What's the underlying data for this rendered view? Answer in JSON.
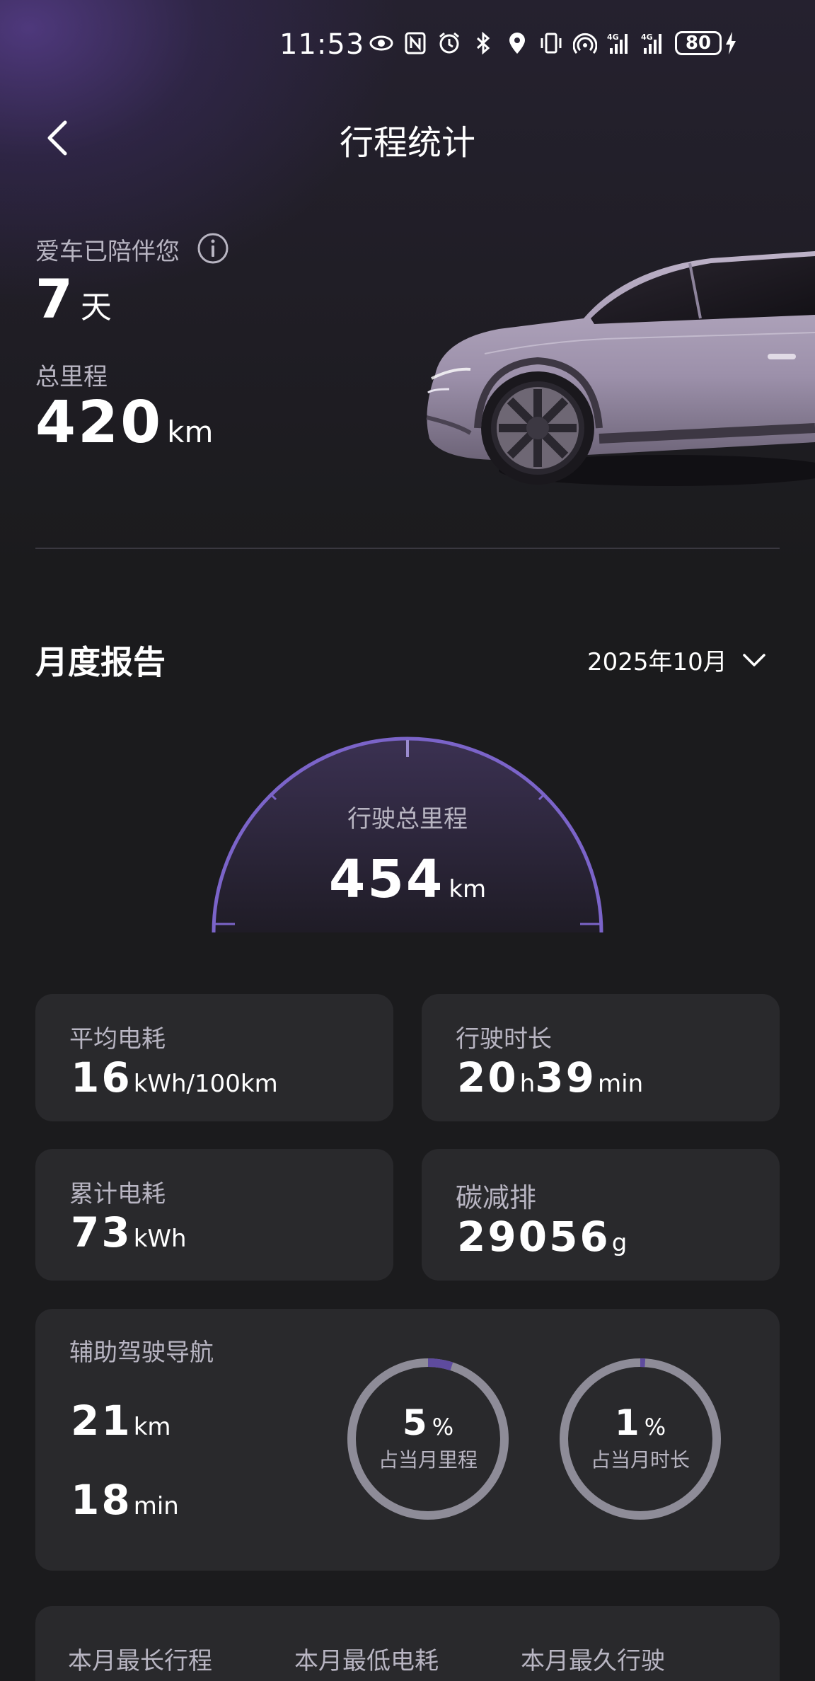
{
  "status_bar": {
    "time": "11:53",
    "icons": [
      "eye-icon",
      "nfc-icon",
      "alarm-icon",
      "bluetooth-icon",
      "location-icon",
      "vibrate-icon",
      "hotspot-icon",
      "signal-4g-icon",
      "signal-4g-icon"
    ],
    "battery": "80",
    "signal_label": "4G"
  },
  "header": {
    "title": "行程统计",
    "back_icon": "chevron-left-icon"
  },
  "summary": {
    "companion_label": "爱车已陪伴您",
    "days_value": "7",
    "days_unit": "天",
    "mileage_label": "总里程",
    "mileage_value": "420",
    "mileage_unit": "km"
  },
  "report": {
    "title": "月度报告",
    "month": "2025年10月",
    "total_label": "行驶总里程",
    "total_value": "454",
    "total_unit": "km"
  },
  "cards": {
    "avg_consumption": {
      "label": "平均电耗",
      "value": "16",
      "unit": "kWh/100km"
    },
    "drive_time": {
      "label": "行驶时长",
      "hours": "20",
      "hours_unit": "h",
      "minutes": "39",
      "minutes_unit": "min"
    },
    "total_consumption": {
      "label": "累计电耗",
      "value": "73",
      "unit": "kWh"
    },
    "carbon": {
      "label": "碳减排",
      "value": "29056",
      "unit": "g"
    }
  },
  "assist": {
    "label": "辅助驾驶导航",
    "distance_value": "21",
    "distance_unit": "km",
    "time_value": "18",
    "time_unit": "min",
    "mileage_ratio": {
      "value": "5",
      "unit": "%",
      "caption": "占当月里程",
      "fraction": 0.05
    },
    "time_ratio": {
      "value": "1",
      "unit": "%",
      "caption": "占当月时长",
      "fraction": 0.01
    }
  },
  "bottom_labels": [
    "本月最长行程",
    "本月最低电耗",
    "本月最久行驶"
  ],
  "colors": {
    "accent": "#7b64c9",
    "ring_track": "#8e8c98",
    "card_bg": "#29292c",
    "page_bg": "#1b1b1d"
  }
}
